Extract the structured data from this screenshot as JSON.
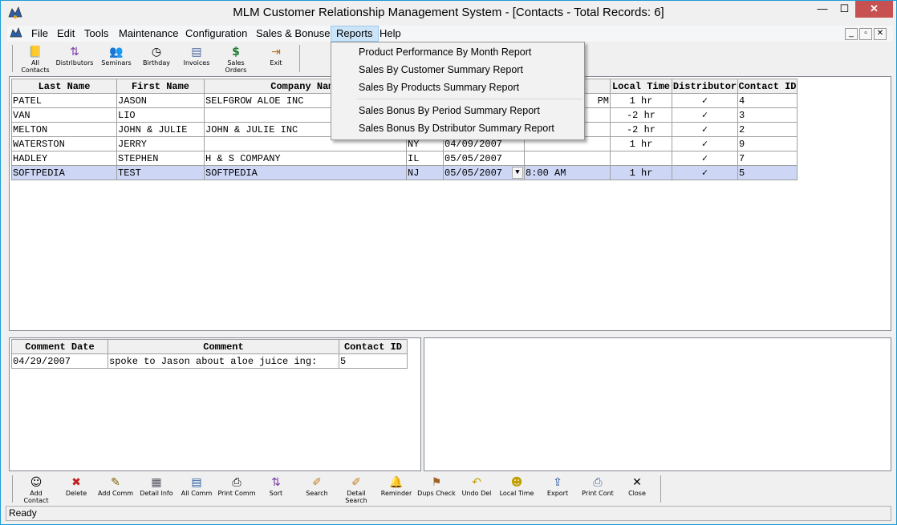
{
  "window": {
    "title": "MLM Customer Relationship Management System - [Contacts - Total Records: 6]",
    "min_glyph": "—",
    "max_glyph": "☐",
    "close_glyph": "✕"
  },
  "menubar": {
    "items": [
      "File",
      "Edit",
      "Tools",
      "Maintenance",
      "Configuration",
      "Sales & Bonuses",
      "Reports",
      "Help"
    ],
    "active": "Reports",
    "mdi": [
      "_",
      "▫",
      "✕"
    ]
  },
  "toolbar": {
    "buttons": [
      {
        "label": "All Contacts",
        "icon": "contacts-book-icon",
        "glyph": "📒"
      },
      {
        "label": "Distributors",
        "icon": "sort-az-icon",
        "glyph": "⇅"
      },
      {
        "label": "Seminars",
        "icon": "people-icon",
        "glyph": "👥"
      },
      {
        "label": "Birthday",
        "icon": "clock-icon",
        "glyph": "◷"
      },
      {
        "label": "Invoices",
        "icon": "invoice-icon",
        "glyph": "▤"
      },
      {
        "label": "Sales Orders",
        "icon": "money-bag-icon",
        "glyph": "$"
      },
      {
        "label": "Exit",
        "icon": "exit-door-icon",
        "glyph": "⇥"
      }
    ]
  },
  "reports_menu": {
    "items": [
      "Product Performance By Month Report",
      "Sales By Customer Summary Report",
      "Sales By Products Summary Report",
      "Sales Bonus By Period Summary Report",
      "Sales Bonus By Dstributor Summary Report"
    ]
  },
  "contacts": {
    "columns": [
      "Last Name",
      "First Name",
      "Company Name",
      "",
      "",
      "",
      "Local Time",
      "Distributor",
      "Contact ID"
    ],
    "rows": [
      [
        "PATEL",
        "JASON",
        "SELFGROW ALOE INC",
        "",
        "",
        "PM",
        "1 hr",
        "✓",
        "4"
      ],
      [
        "VAN",
        "LIO",
        "",
        "",
        "",
        "",
        "-2 hr",
        "✓",
        "3"
      ],
      [
        "MELTON",
        "JOHN & JULIE",
        "JOHN & JULIE INC",
        "",
        "",
        "",
        "-2 hr",
        "✓",
        "2"
      ],
      [
        "WATERSTON",
        "JERRY",
        "",
        "NY",
        "04/09/2007",
        "",
        "1 hr",
        "✓",
        "9"
      ],
      [
        "HADLEY",
        "STEPHEN",
        "H & S COMPANY",
        "IL",
        "05/05/2007",
        "",
        "",
        "✓",
        "7"
      ],
      [
        "SOFTPEDIA",
        "TEST",
        "SOFTPEDIA",
        "NJ",
        "05/05/2007",
        "8:00 AM",
        "1 hr",
        "✓",
        "5"
      ]
    ],
    "selected_row": 5
  },
  "comments": {
    "columns": [
      "Comment Date",
      "Comment",
      "Contact ID"
    ],
    "rows": [
      [
        "04/29/2007",
        "spoke to Jason about aloe juice ing:",
        "5"
      ]
    ]
  },
  "bottom_toolbar": {
    "buttons": [
      {
        "label": "Add Contact",
        "icon": "add-contact-icon",
        "glyph": "☺"
      },
      {
        "label": "Delete",
        "icon": "delete-icon",
        "glyph": "✖"
      },
      {
        "label": "Add Comm",
        "icon": "pencil-icon",
        "glyph": "✎"
      },
      {
        "label": "Detail Info",
        "icon": "clipboard-icon",
        "glyph": "▦"
      },
      {
        "label": "All Comm",
        "icon": "document-icon",
        "glyph": "▤"
      },
      {
        "label": "Print Comm",
        "icon": "printer-icon",
        "glyph": "⎙"
      },
      {
        "label": "Sort",
        "icon": "sort-az-icon",
        "glyph": "⇅"
      },
      {
        "label": "Search",
        "icon": "search-icon",
        "glyph": "✐"
      },
      {
        "label": "Detail Search",
        "icon": "detail-search-icon",
        "glyph": "✐"
      },
      {
        "label": "Reminder",
        "icon": "bell-icon",
        "glyph": "🔔"
      },
      {
        "label": "Dups Check",
        "icon": "dups-check-icon",
        "glyph": "⚑"
      },
      {
        "label": "Undo Del",
        "icon": "undo-icon",
        "glyph": "↶"
      },
      {
        "label": "Local Time",
        "icon": "clock-person-icon",
        "glyph": "☻"
      },
      {
        "label": "Export",
        "icon": "export-icon",
        "glyph": "⇪"
      },
      {
        "label": "Print Cont",
        "icon": "printer-icon",
        "glyph": "⎙"
      },
      {
        "label": "Close",
        "icon": "close-icon",
        "glyph": "✕"
      }
    ]
  },
  "status": {
    "text": "Ready"
  }
}
